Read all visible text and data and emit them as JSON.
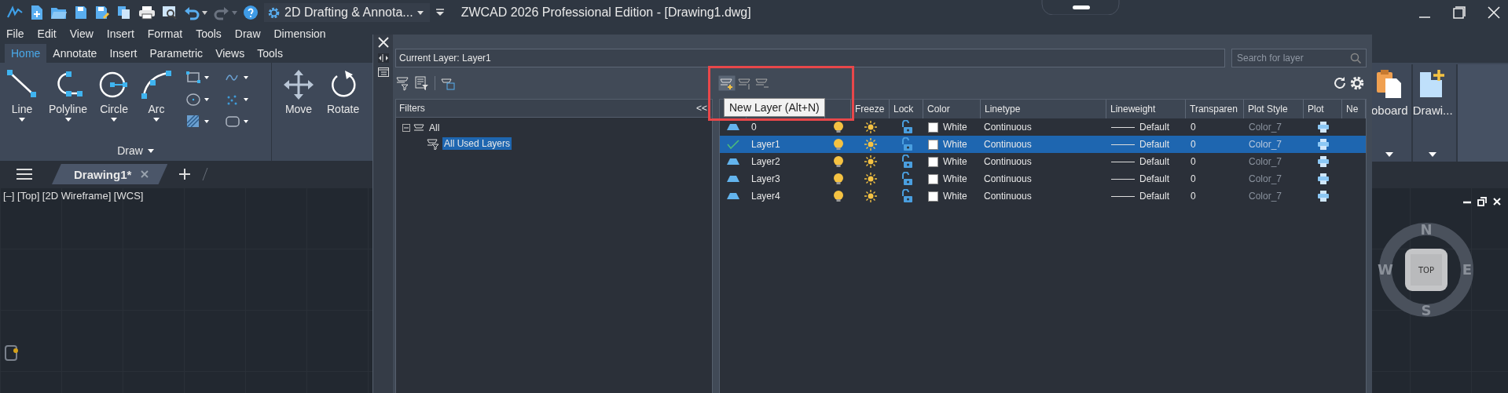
{
  "title_bar": {
    "workspace": "2D Drafting & Annota...",
    "title": "ZWCAD 2026 Professional Edition - [Drawing1.dwg]"
  },
  "menu_bar": [
    "File",
    "Edit",
    "View",
    "Insert",
    "Format",
    "Tools",
    "Draw",
    "Dimension"
  ],
  "ribbon": {
    "tabs": [
      {
        "label": "Home",
        "selected": true
      },
      {
        "label": "Annotate",
        "selected": false
      },
      {
        "label": "Insert",
        "selected": false
      },
      {
        "label": "Parametric",
        "selected": false
      },
      {
        "label": "Views",
        "selected": false
      },
      {
        "label": "Tools",
        "selected": false
      }
    ],
    "draw_tools": [
      {
        "label": "Line",
        "kind": "line"
      },
      {
        "label": "Polyline",
        "kind": "polyline"
      },
      {
        "label": "Circle",
        "kind": "circle"
      },
      {
        "label": "Arc",
        "kind": "arc"
      }
    ],
    "draw_panel_title": "Draw",
    "modify_tools": [
      {
        "label": "Move",
        "kind": "move"
      },
      {
        "label": "Rotate",
        "kind": "rotate"
      }
    ],
    "right_panels": [
      {
        "label": "oboard",
        "kind": "clipboard"
      },
      {
        "label": "Drawi...",
        "kind": "drawing"
      }
    ]
  },
  "document_tabs": [
    {
      "label": "Drawing1*",
      "selected": true
    }
  ],
  "viewport": {
    "label": "[–] [Top] [2D Wireframe] [WCS]",
    "viewcube": {
      "face": "TOP",
      "north": "N",
      "south": "S",
      "east": "E",
      "west": "W"
    }
  },
  "layer_dialog": {
    "current_layer": "Current Layer: Layer1",
    "search": {
      "placeholder": "Search for layer"
    },
    "tooltip": "New Layer (Alt+N)",
    "filters": {
      "header": "Filters",
      "collapse": "<<",
      "tree": [
        {
          "label": "All",
          "expanded": true,
          "selected": false,
          "children": [
            {
              "label": "All Used Layers",
              "selected": true
            }
          ]
        }
      ]
    },
    "columns": [
      "Freeze",
      "Lock",
      "Color",
      "Linetype",
      "Lineweight",
      "Transparen",
      "Plot Style",
      "Plot",
      "Ne"
    ],
    "rows": [
      {
        "name": "0",
        "current": false,
        "selected": false,
        "on": true,
        "frozen": false,
        "locked": false,
        "color": "#ffffff",
        "color_name": "White",
        "linetype": "Continuous",
        "lineweight": "Default",
        "transparency": "0",
        "plot_style": "Color_7",
        "plot": true
      },
      {
        "name": "Layer1",
        "current": true,
        "selected": true,
        "on": true,
        "frozen": false,
        "locked": false,
        "color": "#ffffff",
        "color_name": "White",
        "linetype": "Continuous",
        "lineweight": "Default",
        "transparency": "0",
        "plot_style": "Color_7",
        "plot": true
      },
      {
        "name": "Layer2",
        "current": false,
        "selected": false,
        "on": true,
        "frozen": false,
        "locked": false,
        "color": "#ffffff",
        "color_name": "White",
        "linetype": "Continuous",
        "lineweight": "Default",
        "transparency": "0",
        "plot_style": "Color_7",
        "plot": true
      },
      {
        "name": "Layer3",
        "current": false,
        "selected": false,
        "on": true,
        "frozen": false,
        "locked": false,
        "color": "#ffffff",
        "color_name": "White",
        "linetype": "Continuous",
        "lineweight": "Default",
        "transparency": "0",
        "plot_style": "Color_7",
        "plot": true
      },
      {
        "name": "Layer4",
        "current": false,
        "selected": false,
        "on": true,
        "frozen": false,
        "locked": false,
        "color": "#ffffff",
        "color_name": "White",
        "linetype": "Continuous",
        "lineweight": "Default",
        "transparency": "0",
        "plot_style": "Color_7",
        "plot": true
      }
    ]
  }
}
